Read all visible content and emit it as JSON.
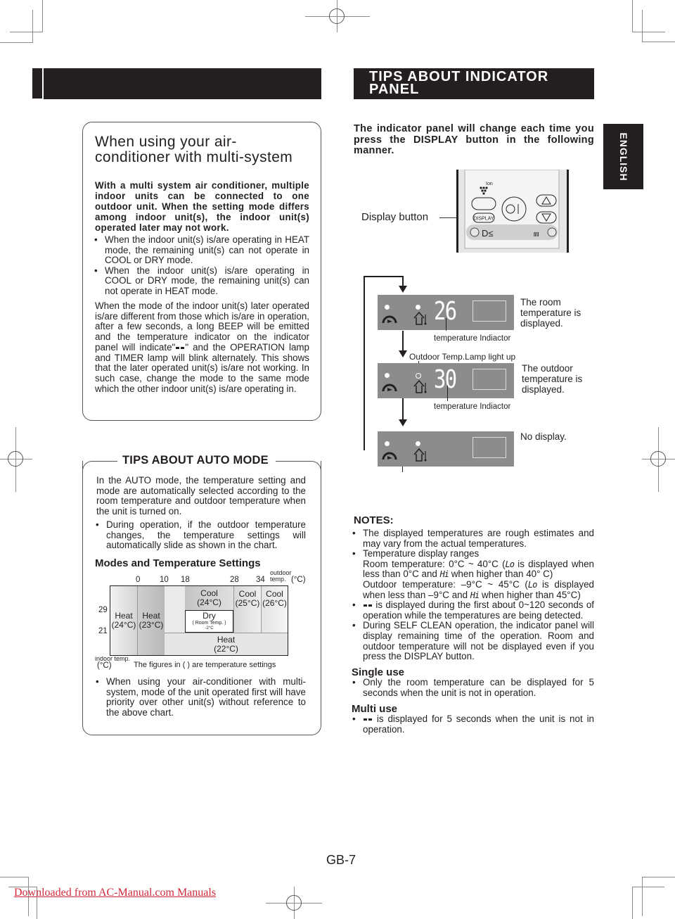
{
  "left_section": {
    "multi_system": {
      "title": "When using your air-conditioner with multi-system",
      "intro": "With a multi system air conditioner, multiple indoor units can be connected to one outdoor unit. When the setting mode differs among indoor unit(s), the indoor unit(s) operated later may not work.",
      "bullets": [
        "When the indoor unit(s) is/are operating in HEAT mode, the remaining unit(s) can not operate in COOL or DRY mode.",
        "When the indoor unit(s) is/are operating in COOL or DRY mode, the remaining unit(s) can not operate in HEAT mode."
      ],
      "body_part1": "When the mode of the indoor unit(s) later operated is/are different from those which is/are in operation, after a few seconds, a long BEEP will be emitted and the temperature indicator on the indicator panel will indicate\"",
      "body_part2": "\" and the OPERATION lamp and TIMER lamp will blink alternately. This shows that the later operated unit(s) is/are not working. In such case, change the mode to the same mode which the other indoor unit(s) is/are operating in."
    },
    "auto_mode": {
      "title": "TIPS ABOUT AUTO MODE",
      "body": "In the AUTO mode, the temperature setting and mode are automatically selected according to the room temperature and outdoor temperature when the unit is turned on.",
      "bullet1": "During operation, if the outdoor temperature changes, the temperature settings will automatically slide as shown in the chart.",
      "chart_title": "Modes and Temperature Settings",
      "bullet2": "When using your air-conditioner with multi-system, mode of the unit operated first will have priority over other unit(s) without reference to the above chart."
    }
  },
  "chart_data": {
    "type": "table",
    "title": "Modes and Temperature Settings",
    "xlabel": "outdoor temp. (°C)",
    "ylabel": "indoor temp. (°C)",
    "x_ticks": [
      "0",
      "10",
      "18",
      "28",
      "34"
    ],
    "y_ticks": [
      "29",
      "21"
    ],
    "footnote": "The figures in (  ) are temperature settings",
    "regions": [
      {
        "mode": "Heat",
        "setting": "(24°C)",
        "outdoor": "< 0",
        "indoor": "all"
      },
      {
        "mode": "Heat",
        "setting": "(23°C)",
        "outdoor": "0 – 10",
        "indoor": "all"
      },
      {
        "mode": "Cool",
        "setting": "(24°C)",
        "outdoor": "18 – 28",
        "indoor": "> 29"
      },
      {
        "mode": "Dry",
        "setting": "(Room Temp. -2°C)",
        "outdoor": "18 – 28",
        "indoor": "21 – 29"
      },
      {
        "mode": "Cool",
        "setting": "(25°C)",
        "outdoor": "28 – 34",
        "indoor": "> 21"
      },
      {
        "mode": "Cool",
        "setting": "(26°C)",
        "outdoor": "> 34",
        "indoor": "> 21"
      },
      {
        "mode": "Heat",
        "setting": "(22°C)",
        "outdoor": "> 10",
        "indoor": "< 21 (and < 29 for 10–18)"
      }
    ],
    "labels": {
      "heat": "Heat",
      "cool": "Cool",
      "dry": "Dry",
      "h24": "(24°C)",
      "h23": "(23°C)",
      "c24": "(24°C)",
      "c25": "(25°C)",
      "c26": "(26°C)",
      "h22": "(22°C)",
      "dry_room": "Room Temp.",
      "dry_minus": "-2°C",
      "outdoor": "outdoor",
      "temp": "temp.",
      "unit": "(°C)",
      "indoor": "indoor temp.",
      "indoor_unit": "(°C)"
    }
  },
  "right_section": {
    "header": "TIPS ABOUT INDICATOR PANEL",
    "language_tab": "ENGLISH",
    "intro": "The indicator panel will change each time you press the DISPLAY button in the following manner.",
    "display_button_label": "Display button",
    "remote": {
      "ion_label": "Ion",
      "display_key": "DISPLAY"
    },
    "panels": [
      {
        "digits": "26",
        "caption": "temperature Indiactor",
        "description": "The room temperature is displayed."
      },
      {
        "digits": "30",
        "caption": "temperature Indiactor",
        "lamp_label": "Outdoor Temp.Lamp light up",
        "description": "The outdoor temperature is displayed."
      },
      {
        "digits": "",
        "description": "No display."
      }
    ],
    "notes": {
      "heading": "NOTES:",
      "n1": "The displayed temperatures are rough estimates and may vary from the actual temperatures.",
      "n2_title": "Temperature display ranges",
      "room_a": "Room temperature: 0°C ~ 40°C (",
      "lo": "Lo",
      "room_b": " is displayed when less than 0°C and ",
      "hi": "Hi",
      "room_c": " when higher than 40° C)",
      "out_a": "Outdoor temperature: –9°C ~ 45°C (",
      "out_b": " is displayed when less than –9°C and ",
      "out_c": " when higher than 45°C)",
      "n3": " is displayed during the first about 0~120 seconds of operation while the temperatures are being detected.",
      "n4": "During SELF CLEAN operation, the indicator panel will display remaining time of the operation. Room and outdoor temperature will not be displayed even if you press the DISPLAY button."
    },
    "single_use": {
      "heading": "Single use",
      "text": "Only the room temperature can be displayed for 5 seconds when the unit is not in operation."
    },
    "multi_use": {
      "heading": "Multi use",
      "text": " is displayed for 5 seconds when the unit is not in operation."
    }
  },
  "footer": {
    "page_number": "GB-7",
    "download_link": "Downloaded from AC-Manual.com Manuals"
  }
}
